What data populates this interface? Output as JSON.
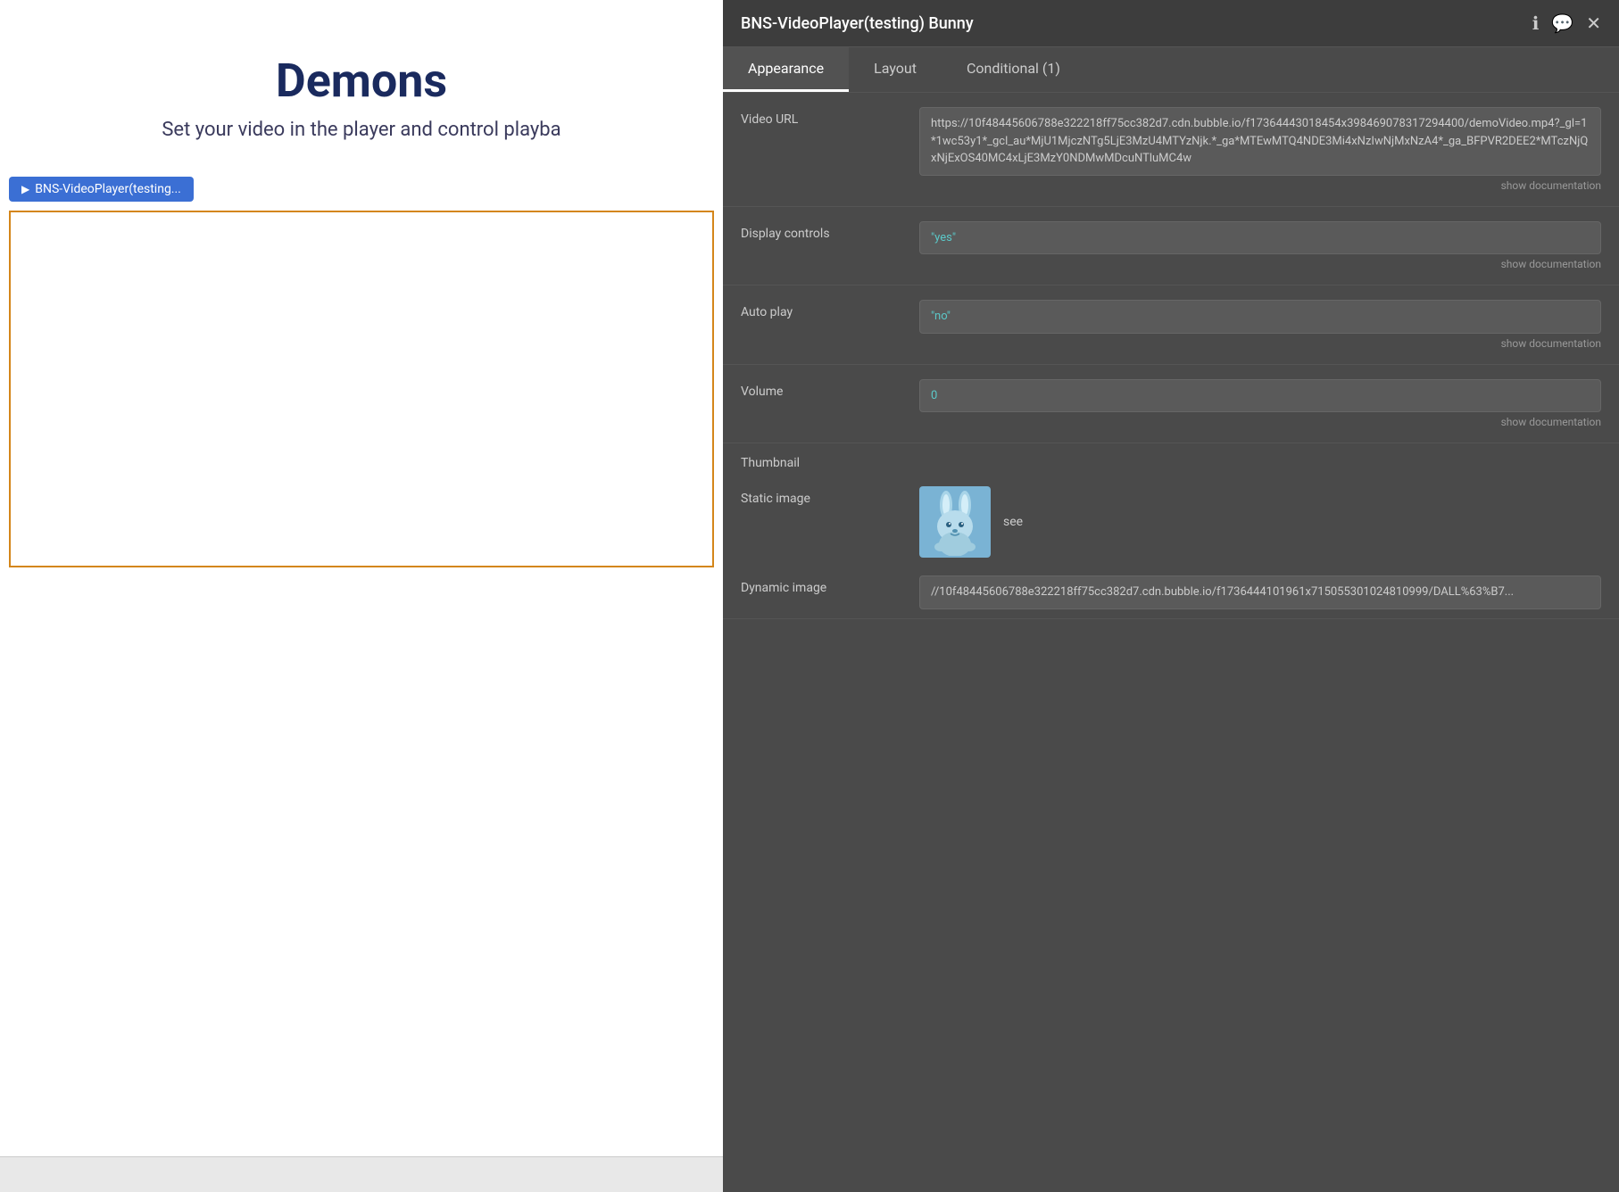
{
  "panel": {
    "title": "BNS-VideoPlayer(testing) Bunny",
    "tabs": [
      {
        "label": "Appearance",
        "active": true
      },
      {
        "label": "Layout",
        "active": false
      },
      {
        "label": "Conditional (1)",
        "active": false
      }
    ],
    "icons": {
      "info": "ℹ",
      "chat": "💬",
      "close": "✕"
    }
  },
  "properties": {
    "video_url": {
      "label": "Video URL",
      "value": "https://10f48445606788e322218ff75cc382d7.cdn.bubble.io/f17364443018454x39846907831729440​0/demoVideo.mp4?_gl=1*1wc53y1*_gcl_au*MjU1MjczNTg5LjE3MzU4MTYzNjk.*_ga*MTEwMTQ4NDE3Mi4xNzIwNjMxNzA4*_ga_BFPVR2DEE2*MTczNjQxNjExOS40MC4xLjE3MzY0NDMwMDcuNTluMC4w",
      "show_doc": "show documentation"
    },
    "display_controls": {
      "label": "Display controls",
      "value": "\"yes\"",
      "show_doc": "show documentation"
    },
    "auto_play": {
      "label": "Auto play",
      "value": "\"no\"",
      "show_doc": "show documentation"
    },
    "volume": {
      "label": "Volume",
      "value": "0",
      "show_doc": "show documentation"
    }
  },
  "thumbnail": {
    "section_label": "Thumbnail",
    "static_image": {
      "label": "Static image",
      "see_label": "see"
    },
    "dynamic_image": {
      "label": "Dynamic image",
      "value": "//10f48445606788e322218ff75cc382d7.cdn.bubble.io/f17364441019​61x71505530102481099​9/DALL%63%B7..."
    }
  },
  "page": {
    "title": "Demons",
    "subtitle": "Set your video in the player and control playba",
    "component_label": "BNS-VideoPlayer(testing..."
  }
}
